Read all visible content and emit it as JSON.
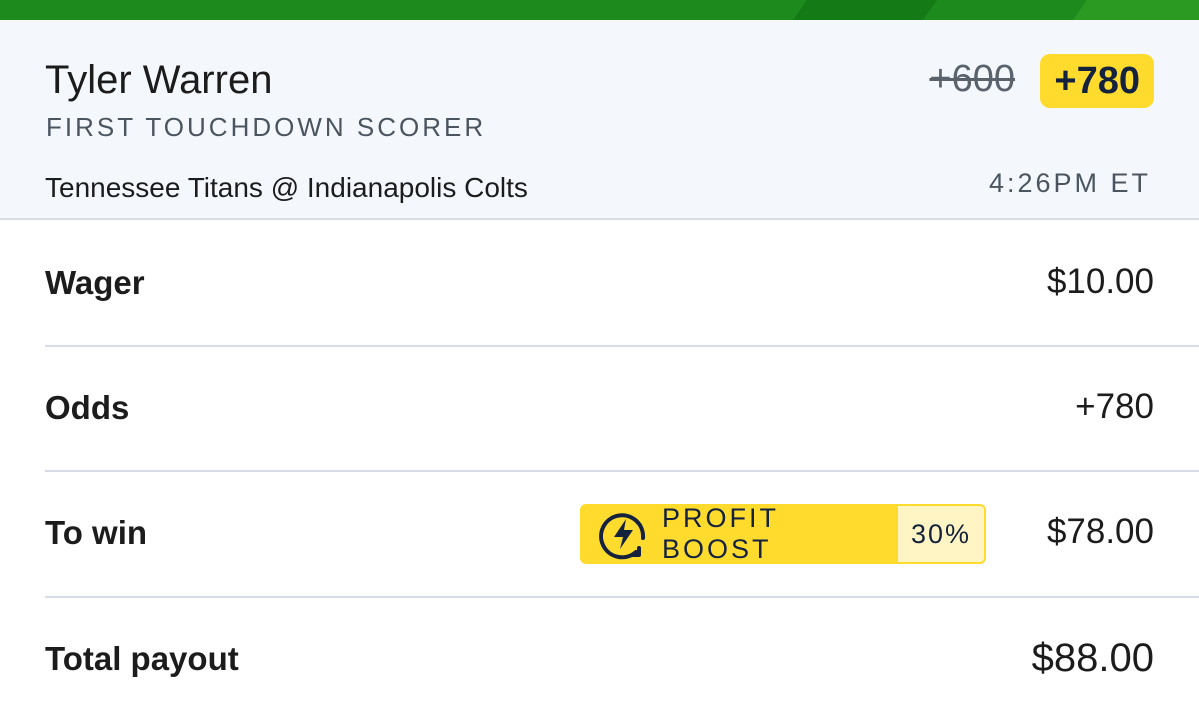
{
  "bet": {
    "player": "Tyler Warren",
    "market": "FIRST TOUCHDOWN SCORER",
    "matchup": "Tennessee Titans @ Indianapolis Colts",
    "time": "4:26PM ET",
    "old_odds": "+600",
    "boosted_odds": "+780"
  },
  "details": {
    "wager_label": "Wager",
    "wager_value": "$10.00",
    "odds_label": "Odds",
    "odds_value": "+780",
    "to_win_label": "To win",
    "to_win_value": "$78.00",
    "payout_label": "Total payout",
    "payout_value": "$88.00"
  },
  "boost": {
    "label": "PROFIT BOOST",
    "percent": "30%",
    "icon": "lightning-bolt-icon"
  },
  "colors": {
    "brand_green": "#1d8a1d",
    "boost_yellow": "#ffdb2e",
    "boost_navy": "#14223d"
  }
}
